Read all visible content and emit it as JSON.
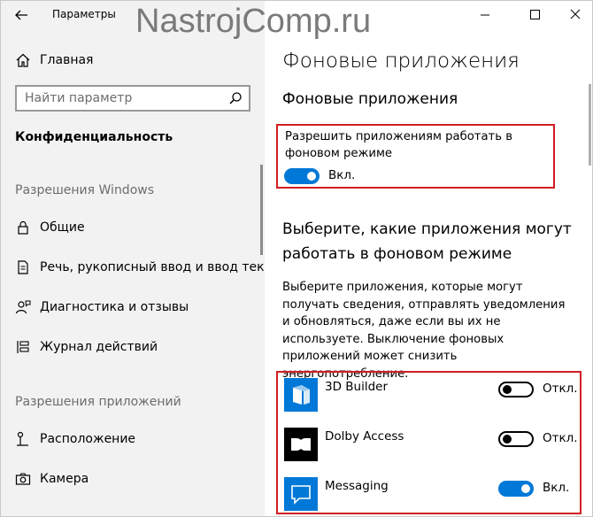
{
  "window": {
    "title": "Параметры",
    "watermark": "NastrojComp.ru"
  },
  "sidebar": {
    "home_label": "Главная",
    "search_placeholder": "Найти параметр",
    "category": "Конфиденциальность",
    "section_windows": "Разрешения Windows",
    "items_windows": [
      {
        "label": "Общие",
        "icon": "lock-icon"
      },
      {
        "label": "Речь, рукописный ввод и ввод текста",
        "icon": "document-pen-icon"
      },
      {
        "label": "Диагностика и отзывы",
        "icon": "person-feedback-icon"
      },
      {
        "label": "Журнал действий",
        "icon": "timeline-icon"
      }
    ],
    "section_apps": "Разрешения приложений",
    "items_apps": [
      {
        "label": "Расположение",
        "icon": "location-icon"
      },
      {
        "label": "Камера",
        "icon": "camera-icon"
      }
    ]
  },
  "main": {
    "title": "Фоновые приложения",
    "subtitle": "Фоновые приложения",
    "master_setting": {
      "label": "Разрешить приложениям работать в фоновом режиме",
      "state": "on",
      "state_label": "Вкл."
    },
    "heading": "Выберите, какие приложения могут работать в фоновом режиме",
    "description": "Выберите приложения, которые могут получать сведения, отправлять уведомления и обновляться, даже если вы их не используете. Выключение фоновых приложений может снизить энергопотребление.",
    "apps": [
      {
        "name": "3D Builder",
        "state": "off",
        "state_label": "Откл.",
        "icon": "3d-builder-icon"
      },
      {
        "name": "Dolby Access",
        "state": "off",
        "state_label": "Откл.",
        "icon": "dolby-icon"
      },
      {
        "name": "Messaging",
        "state": "on",
        "state_label": "Вкл.",
        "icon": "messaging-icon"
      }
    ]
  },
  "colors": {
    "accent": "#0078d7",
    "highlight_border": "#d11d23",
    "sidebar_bg": "#f2f2f2"
  }
}
